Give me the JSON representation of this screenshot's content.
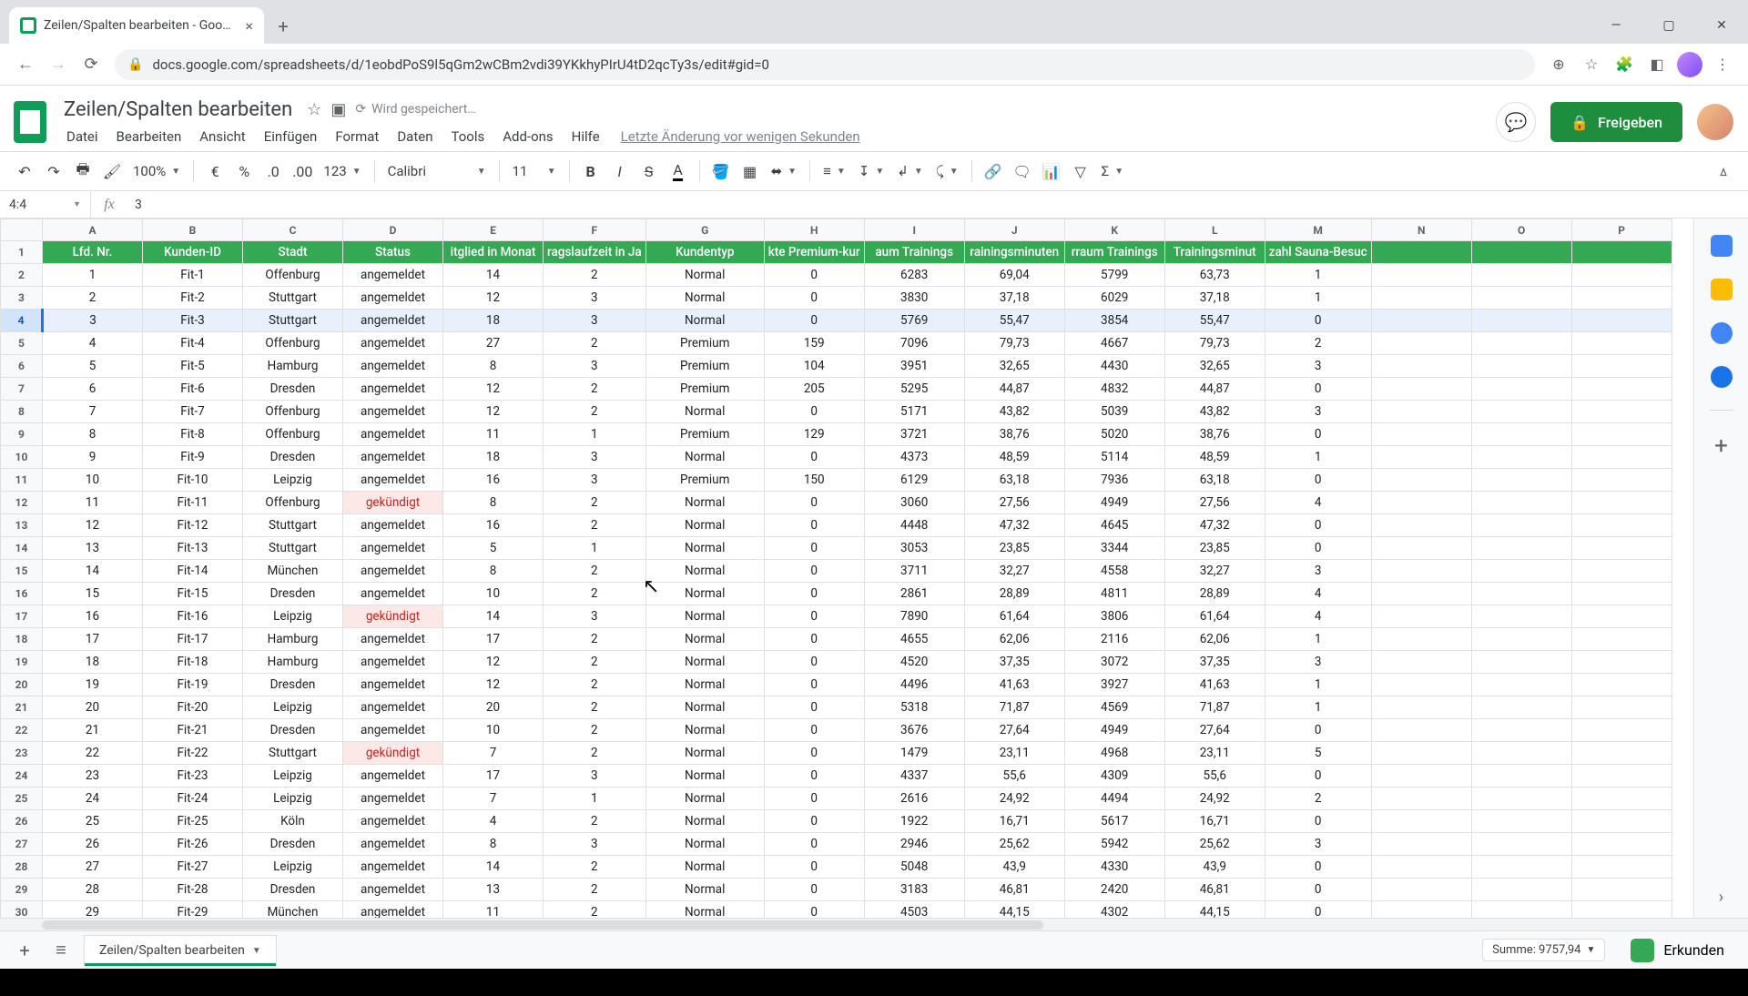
{
  "browser": {
    "tab_title": "Zeilen/Spalten bearbeiten - Goo…",
    "url": "docs.google.com/spreadsheets/d/1eobdPoS9l5qGm2wCBm2vdi39YKkhyPIrU4tD2qcTy3s/edit#gid=0"
  },
  "doc": {
    "title": "Zeilen/Spalten bearbeiten",
    "saving": "Wird gespeichert…",
    "last_edit": "Letzte Änderung vor wenigen Sekunden",
    "share": "Freigeben"
  },
  "menus": [
    "Datei",
    "Bearbeiten",
    "Ansicht",
    "Einfügen",
    "Format",
    "Daten",
    "Tools",
    "Add-ons",
    "Hilfe"
  ],
  "toolbar": {
    "zoom": "100%",
    "currency": "€",
    "percent": "%",
    "dec_less": ".0",
    "dec_more": ".00",
    "num_fmt": "123",
    "font": "Calibri",
    "font_size": "11"
  },
  "namebox": "4:4",
  "formula": "3",
  "sum": "Summe: 9757,94",
  "explore": "Erkunden",
  "sheet_tab": "Zeilen/Spalten bearbeiten",
  "columns": [
    "A",
    "B",
    "C",
    "D",
    "E",
    "F",
    "G",
    "H",
    "I",
    "J",
    "K",
    "L",
    "M",
    "N",
    "O",
    "P"
  ],
  "headers": [
    "Lfd. Nr.",
    "Kunden-ID",
    "Stadt",
    "Status",
    "itglied in Monat",
    "ragslaufzeit in Ja",
    "Kundentyp",
    "kte Premium-kur",
    "aum Trainings",
    "rainingsminuten",
    "rraum Trainings",
    "Trainingsminut",
    "zahl Sauna-Besuc"
  ],
  "selected_row_index": 3,
  "rows": [
    {
      "n": 1,
      "r": [
        1,
        "Fit-1",
        "Offenburg",
        "angemeldet",
        14,
        2,
        "Normal",
        0,
        6283,
        "69,04",
        5799,
        "63,73",
        1
      ]
    },
    {
      "n": 2,
      "r": [
        2,
        "Fit-2",
        "Stuttgart",
        "angemeldet",
        12,
        3,
        "Normal",
        0,
        3830,
        "37,18",
        6029,
        "37,18",
        1
      ]
    },
    {
      "n": 3,
      "r": [
        3,
        "Fit-3",
        "Stuttgart",
        "angemeldet",
        18,
        3,
        "Normal",
        0,
        5769,
        "55,47",
        3854,
        "55,47",
        0
      ]
    },
    {
      "n": 4,
      "r": [
        4,
        "Fit-4",
        "Offenburg",
        "angemeldet",
        27,
        2,
        "Premium",
        159,
        7096,
        "79,73",
        4667,
        "79,73",
        2
      ]
    },
    {
      "n": 5,
      "r": [
        5,
        "Fit-5",
        "Hamburg",
        "angemeldet",
        8,
        3,
        "Premium",
        104,
        3951,
        "32,65",
        4430,
        "32,65",
        3
      ]
    },
    {
      "n": 6,
      "r": [
        6,
        "Fit-6",
        "Dresden",
        "angemeldet",
        12,
        2,
        "Premium",
        205,
        5295,
        "44,87",
        4832,
        "44,87",
        0
      ]
    },
    {
      "n": 7,
      "r": [
        7,
        "Fit-7",
        "Offenburg",
        "angemeldet",
        12,
        2,
        "Normal",
        0,
        5171,
        "43,82",
        5039,
        "43,82",
        3
      ]
    },
    {
      "n": 8,
      "r": [
        8,
        "Fit-8",
        "Offenburg",
        "angemeldet",
        11,
        1,
        "Premium",
        129,
        3721,
        "38,76",
        5020,
        "38,76",
        0
      ]
    },
    {
      "n": 9,
      "r": [
        9,
        "Fit-9",
        "Dresden",
        "angemeldet",
        18,
        3,
        "Normal",
        0,
        4373,
        "48,59",
        5114,
        "48,59",
        1
      ]
    },
    {
      "n": 10,
      "r": [
        10,
        "Fit-10",
        "Leipzig",
        "angemeldet",
        16,
        3,
        "Premium",
        150,
        6129,
        "63,18",
        7936,
        "63,18",
        0
      ]
    },
    {
      "n": 11,
      "r": [
        11,
        "Fit-11",
        "Offenburg",
        "gekündigt",
        8,
        2,
        "Normal",
        0,
        3060,
        "27,56",
        4949,
        "27,56",
        4
      ]
    },
    {
      "n": 12,
      "r": [
        12,
        "Fit-12",
        "Stuttgart",
        "angemeldet",
        16,
        2,
        "Normal",
        0,
        4448,
        "47,32",
        4645,
        "47,32",
        0
      ]
    },
    {
      "n": 13,
      "r": [
        13,
        "Fit-13",
        "Stuttgart",
        "angemeldet",
        5,
        1,
        "Normal",
        0,
        3053,
        "23,85",
        3344,
        "23,85",
        0
      ]
    },
    {
      "n": 14,
      "r": [
        14,
        "Fit-14",
        "München",
        "angemeldet",
        8,
        2,
        "Normal",
        0,
        3711,
        "32,27",
        4558,
        "32,27",
        3
      ]
    },
    {
      "n": 15,
      "r": [
        15,
        "Fit-15",
        "Dresden",
        "angemeldet",
        10,
        2,
        "Normal",
        0,
        2861,
        "28,89",
        4811,
        "28,89",
        4
      ]
    },
    {
      "n": 16,
      "r": [
        16,
        "Fit-16",
        "Leipzig",
        "gekündigt",
        14,
        3,
        "Normal",
        0,
        7890,
        "61,64",
        3806,
        "61,64",
        4
      ]
    },
    {
      "n": 17,
      "r": [
        17,
        "Fit-17",
        "Hamburg",
        "angemeldet",
        17,
        2,
        "Normal",
        0,
        4655,
        "62,06",
        2116,
        "62,06",
        1
      ]
    },
    {
      "n": 18,
      "r": [
        18,
        "Fit-18",
        "Hamburg",
        "angemeldet",
        12,
        2,
        "Normal",
        0,
        4520,
        "37,35",
        3072,
        "37,35",
        3
      ]
    },
    {
      "n": 19,
      "r": [
        19,
        "Fit-19",
        "Dresden",
        "angemeldet",
        12,
        2,
        "Normal",
        0,
        4496,
        "41,63",
        3927,
        "41,63",
        1
      ]
    },
    {
      "n": 20,
      "r": [
        20,
        "Fit-20",
        "Leipzig",
        "angemeldet",
        20,
        2,
        "Normal",
        0,
        5318,
        "71,87",
        4569,
        "71,87",
        1
      ]
    },
    {
      "n": 21,
      "r": [
        21,
        "Fit-21",
        "Dresden",
        "angemeldet",
        10,
        2,
        "Normal",
        0,
        3676,
        "27,64",
        4949,
        "27,64",
        0
      ]
    },
    {
      "n": 22,
      "r": [
        22,
        "Fit-22",
        "Stuttgart",
        "gekündigt",
        7,
        2,
        "Normal",
        0,
        1479,
        "23,11",
        4968,
        "23,11",
        5
      ]
    },
    {
      "n": 23,
      "r": [
        23,
        "Fit-23",
        "Leipzig",
        "angemeldet",
        17,
        3,
        "Normal",
        0,
        4337,
        "55,6",
        4309,
        "55,6",
        0
      ]
    },
    {
      "n": 24,
      "r": [
        24,
        "Fit-24",
        "Leipzig",
        "angemeldet",
        7,
        1,
        "Normal",
        0,
        2616,
        "24,92",
        4494,
        "24,92",
        2
      ]
    },
    {
      "n": 25,
      "r": [
        25,
        "Fit-25",
        "Köln",
        "angemeldet",
        4,
        2,
        "Normal",
        0,
        1922,
        "16,71",
        5617,
        "16,71",
        0
      ]
    },
    {
      "n": 26,
      "r": [
        26,
        "Fit-26",
        "Dresden",
        "angemeldet",
        8,
        3,
        "Normal",
        0,
        2946,
        "25,62",
        5942,
        "25,62",
        3
      ]
    },
    {
      "n": 27,
      "r": [
        27,
        "Fit-27",
        "Leipzig",
        "angemeldet",
        14,
        2,
        "Normal",
        0,
        5048,
        "43,9",
        4330,
        "43,9",
        0
      ]
    },
    {
      "n": 28,
      "r": [
        28,
        "Fit-28",
        "Dresden",
        "angemeldet",
        13,
        2,
        "Normal",
        0,
        3183,
        "46,81",
        2420,
        "46,81",
        0
      ]
    },
    {
      "n": 29,
      "r": [
        29,
        "Fit-29",
        "München",
        "angemeldet",
        11,
        2,
        "Normal",
        0,
        4503,
        "44,15",
        4302,
        "44,15",
        0
      ]
    }
  ]
}
